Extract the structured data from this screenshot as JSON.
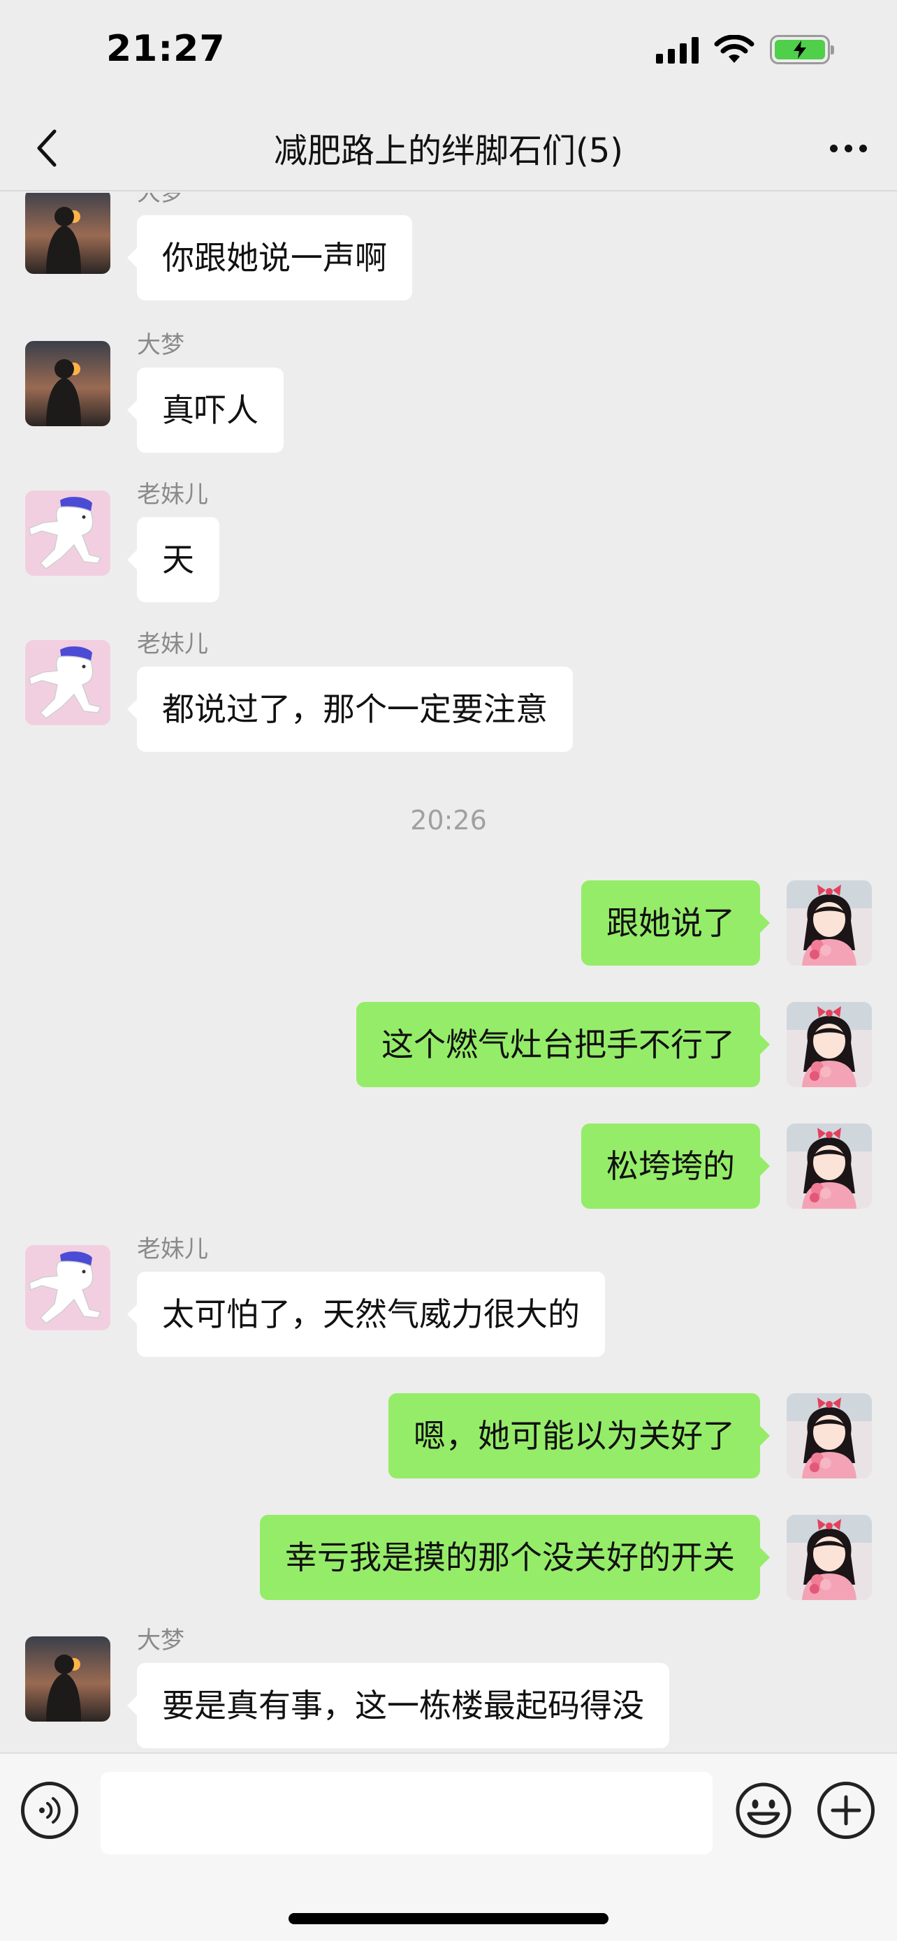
{
  "status_bar": {
    "time": "21:27"
  },
  "header": {
    "title": "减肥路上的绊脚石们(5)"
  },
  "chat": {
    "messages": [
      {
        "sender": "大梦",
        "text": "你跟她说一声啊",
        "avatar": "sunset-avatar"
      },
      {
        "sender": "大梦",
        "text": "真吓人",
        "avatar": "sunset-avatar"
      },
      {
        "sender": "老妹儿",
        "text": "天",
        "avatar": "cartoon-avatar"
      },
      {
        "sender": "老妹儿",
        "text": "都说过了，那个一定要注意",
        "avatar": "cartoon-avatar"
      },
      {
        "time_divider": "20:26"
      },
      {
        "text": "跟她说了",
        "avatar": "girl-avatar"
      },
      {
        "text": "这个燃气灶台把手不行了",
        "avatar": "girl-avatar"
      },
      {
        "text": "松垮垮的",
        "avatar": "girl-avatar"
      },
      {
        "sender": "老妹儿",
        "text": "太可怕了，天然气威力很大的",
        "avatar": "cartoon-avatar"
      },
      {
        "text": "嗯，她可能以为关好了",
        "avatar": "girl-avatar"
      },
      {
        "text": "幸亏我是摸的那个没关好的开关",
        "avatar": "girl-avatar"
      },
      {
        "sender": "大梦",
        "text": "要是真有事，这一栋楼最起码得没",
        "avatar": "sunset-avatar"
      }
    ]
  },
  "input_bar": {
    "value": ""
  },
  "colors": {
    "outgoing_bubble": "#95ec69",
    "incoming_bubble": "#ffffff",
    "background": "#ededed"
  }
}
